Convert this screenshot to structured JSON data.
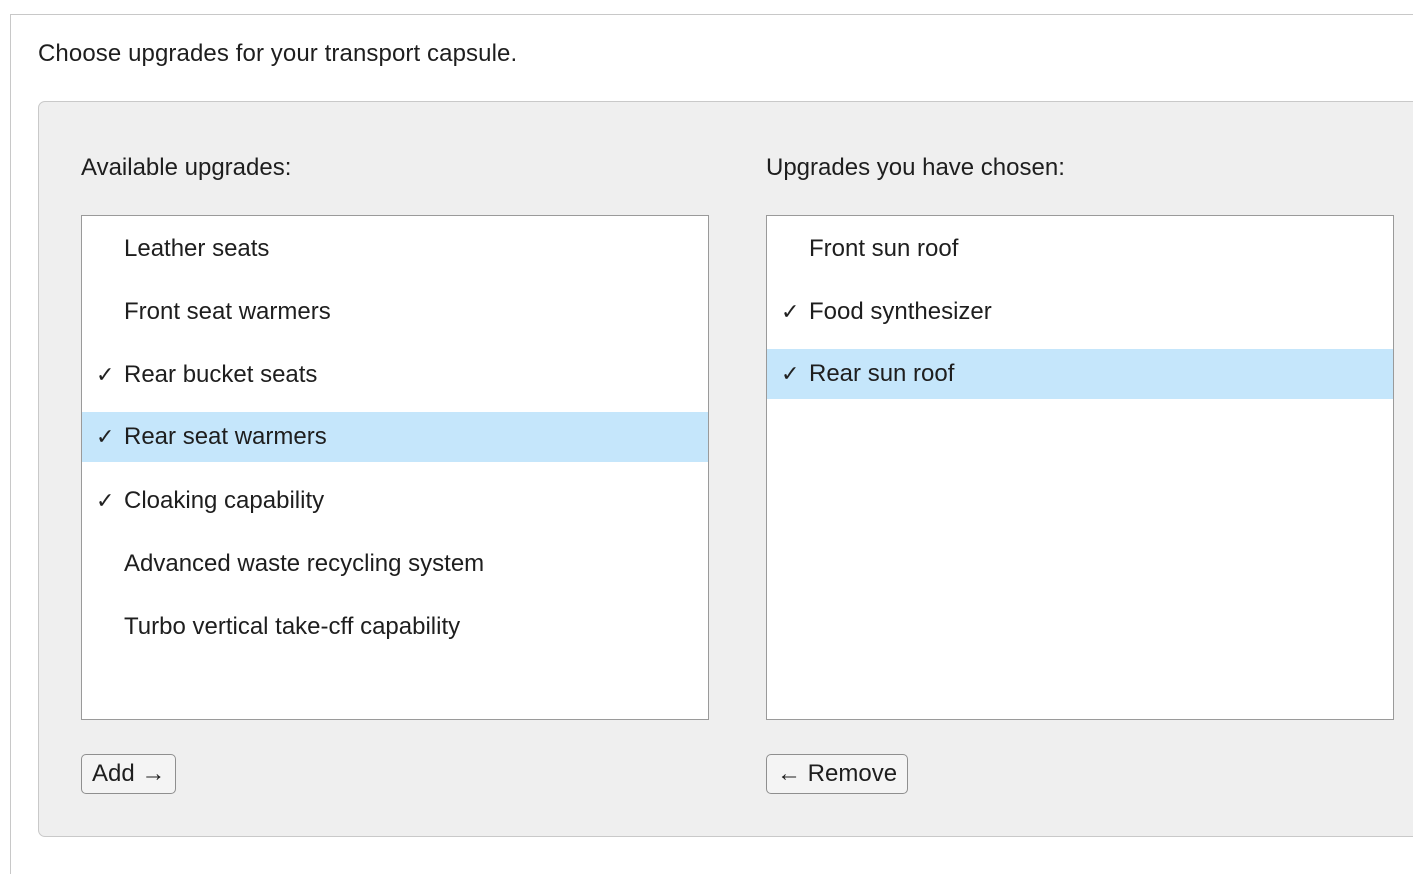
{
  "intro_text": "Choose upgrades for your transport capsule.",
  "available": {
    "label": "Available upgrades:",
    "items": [
      {
        "label": "Leather seats",
        "check": ""
      },
      {
        "label": "Front seat warmers",
        "check": ""
      },
      {
        "label": "Rear bucket seats",
        "check": "✓"
      },
      {
        "label": "Rear seat warmers",
        "check": "✓"
      },
      {
        "label": "Cloaking capability",
        "check": "✓"
      },
      {
        "label": "Advanced waste recycling system",
        "check": ""
      },
      {
        "label": "Turbo vertical take-cff capability",
        "check": ""
      }
    ],
    "button_label": "Add →"
  },
  "chosen": {
    "label": "Upgrades you have chosen:",
    "items": [
      {
        "label": "Front sun roof",
        "check": ""
      },
      {
        "label": "Food synthesizer",
        "check": "✓"
      },
      {
        "label": "Rear sun roof",
        "check": "✓"
      }
    ],
    "button_label": "← Remove"
  },
  "colors": {
    "selected_row": "#c5e6fb",
    "panel_bg": "#efefef"
  }
}
